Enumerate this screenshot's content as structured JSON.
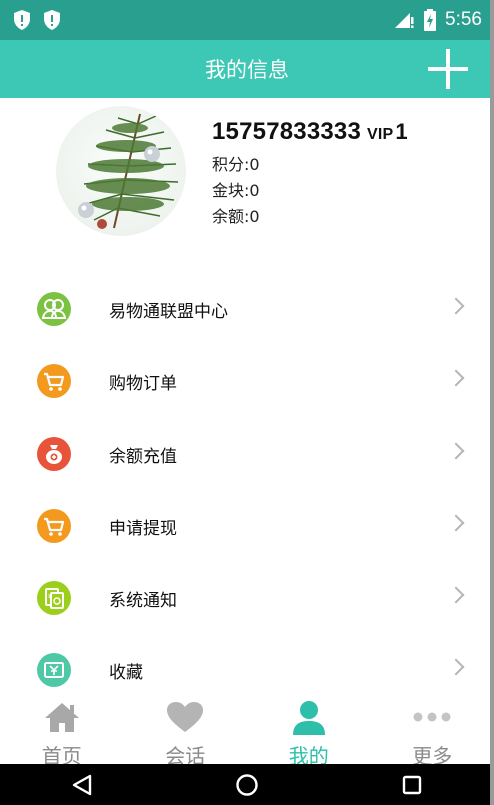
{
  "status_bar": {
    "time": "5:56"
  },
  "header": {
    "title": "我的信息"
  },
  "profile": {
    "phone": "15757833333",
    "vip_label": "VIP",
    "vip_level": "1",
    "points": "积分:0",
    "gold": "金块:0",
    "balance": "余额:0"
  },
  "menu": [
    {
      "label": "易物通联盟中心",
      "icon": "alliance-icon",
      "color": "#7cc242"
    },
    {
      "label": "购物订单",
      "icon": "cart-icon",
      "color": "#f39a1e"
    },
    {
      "label": "余额充值",
      "icon": "money-bag-icon",
      "color": "#e8543a"
    },
    {
      "label": "申请提现",
      "icon": "cart-icon",
      "color": "#f39a1e"
    },
    {
      "label": "系统通知",
      "icon": "notice-icon",
      "color": "#9ccf1c"
    },
    {
      "label": "收藏",
      "icon": "yen-card-icon",
      "color": "#4fc8a8"
    }
  ],
  "tabs": [
    {
      "label": "首页",
      "icon": "home-icon"
    },
    {
      "label": "会话",
      "icon": "heart-icon"
    },
    {
      "label": "我的",
      "icon": "person-icon",
      "active": true
    },
    {
      "label": "更多",
      "icon": "more-icon"
    }
  ],
  "colors": {
    "status_bar": "#29a08f",
    "header": "#3cc8b4",
    "accent": "#2dbfa9"
  }
}
